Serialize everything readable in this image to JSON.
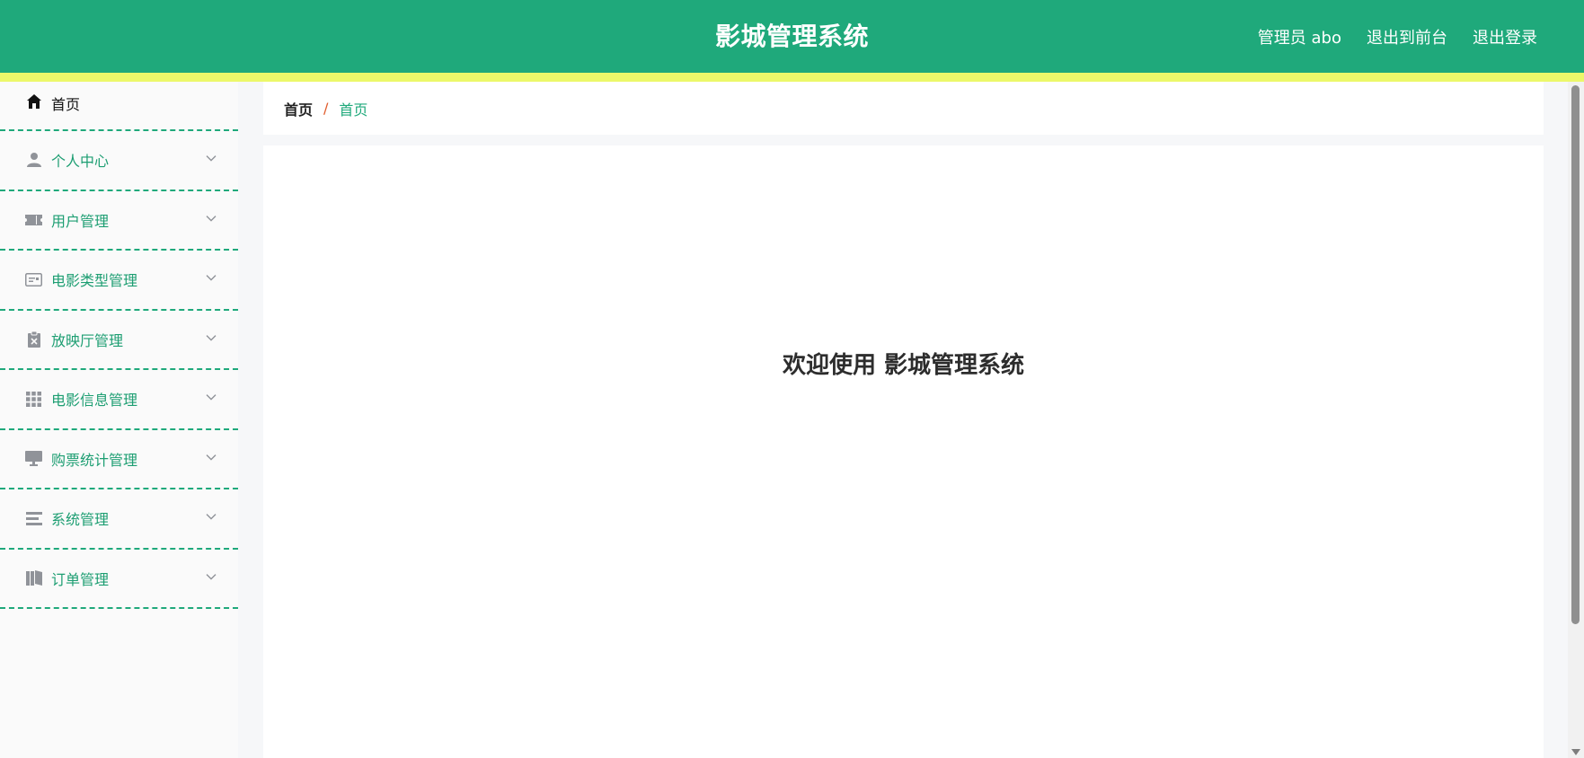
{
  "header": {
    "title": "影城管理系统",
    "admin_label": "管理员 abo",
    "exit_frontend": "退出到前台",
    "logout": "退出登录"
  },
  "sidebar": {
    "items": [
      {
        "label": "首页",
        "icon": "home-icon"
      },
      {
        "label": "个人中心",
        "icon": "user-icon"
      },
      {
        "label": "用户管理",
        "icon": "ticket-icon"
      },
      {
        "label": "电影类型管理",
        "icon": "id-card-icon"
      },
      {
        "label": "放映厅管理",
        "icon": "clipboard-icon"
      },
      {
        "label": "电影信息管理",
        "icon": "grid-icon"
      },
      {
        "label": "购票统计管理",
        "icon": "monitor-icon"
      },
      {
        "label": "系统管理",
        "icon": "list-icon"
      },
      {
        "label": "订单管理",
        "icon": "book-icon"
      }
    ]
  },
  "breadcrumb": {
    "root": "首页",
    "separator": "/",
    "current": "首页"
  },
  "main": {
    "welcome": "欢迎使用 影城管理系统"
  },
  "colors": {
    "brand": "#1fa97b",
    "accent_line": "#ecf86a",
    "separator": "#e05a2a"
  }
}
